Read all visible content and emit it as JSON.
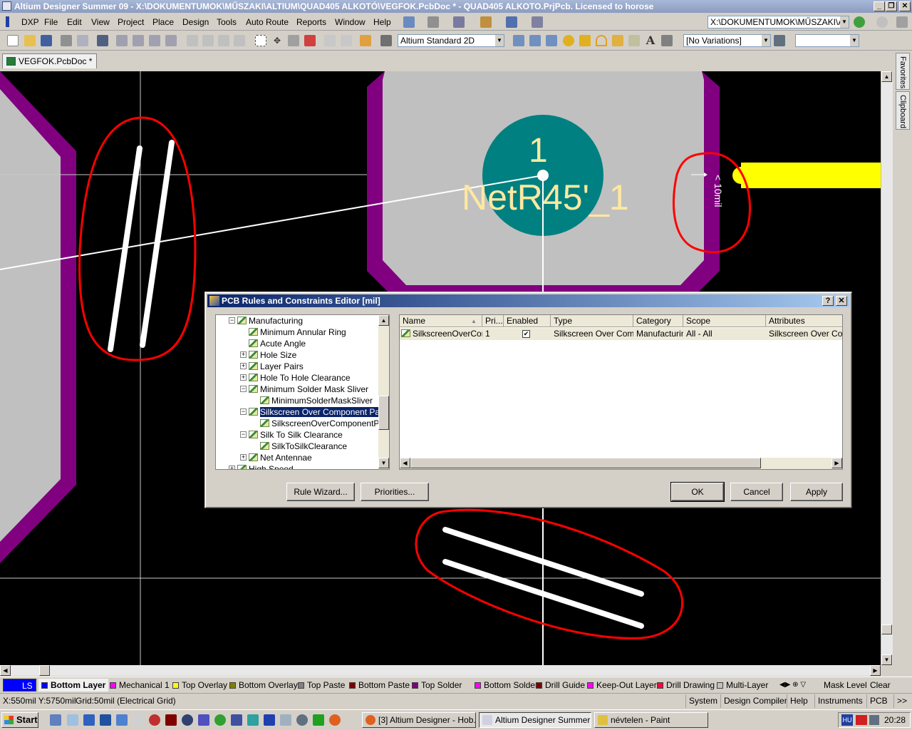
{
  "titlebar": {
    "text": "Altium Designer Summer 09 - X:\\DOKUMENTUMOK\\MŰSZAKI\\ALTIUM\\QUAD405 ALKOTÓ\\VEGFOK.PcbDoc * - QUAD405 ALKOTO.PrjPcb. Licensed to horose"
  },
  "menu": {
    "dxp": "DXP",
    "file": "File",
    "edit": "Edit",
    "view": "View",
    "project": "Project",
    "place": "Place",
    "design": "Design",
    "tools": "Tools",
    "autoroute": "Auto Route",
    "reports": "Reports",
    "window": "Window",
    "help": "Help"
  },
  "path_combo": "X:\\DOKUMENTUMOK\\MŰSZAKI\\ALTIUM",
  "toolbar": {
    "view_mode": "Altium Standard 2D",
    "variations": "[No Variations]",
    "extra": ""
  },
  "doc_tab": "VEGFOK.PcbDoc *",
  "side_tabs": {
    "favorites": "Favorites",
    "clipboard": "Clipboard"
  },
  "pcb": {
    "pad_number": "1",
    "net_name": "NetR45'_1",
    "clearance_label": "< 10mil"
  },
  "dialog": {
    "title": "PCB Rules and Constraints Editor [mil]",
    "help_btn": "?",
    "close_btn": "✕",
    "tree": [
      {
        "label": "Manufacturing",
        "level": 1,
        "expander": "−"
      },
      {
        "label": "Minimum Annular Ring",
        "level": 2,
        "expander": ""
      },
      {
        "label": "Acute Angle",
        "level": 2,
        "expander": ""
      },
      {
        "label": "Hole Size",
        "level": 2,
        "expander": "+"
      },
      {
        "label": "Layer Pairs",
        "level": 2,
        "expander": "+"
      },
      {
        "label": "Hole To Hole Clearance",
        "level": 2,
        "expander": "+"
      },
      {
        "label": "Minimum Solder Mask Sliver",
        "level": 2,
        "expander": "−"
      },
      {
        "label": "MinimumSolderMaskSliver",
        "level": 3,
        "expander": ""
      },
      {
        "label": "Silkscreen Over Component Pads",
        "level": 2,
        "expander": "−"
      },
      {
        "label": "SilkscreenOverComponentPad",
        "level": 3,
        "expander": ""
      },
      {
        "label": "Silk To Silk Clearance",
        "level": 2,
        "expander": "−"
      },
      {
        "label": "SilkToSilkClearance",
        "level": 3,
        "expander": ""
      },
      {
        "label": "Net Antennae",
        "level": 2,
        "expander": "+"
      },
      {
        "label": "High Speed",
        "level": 1,
        "expander": "+"
      }
    ],
    "columns": [
      "Name",
      "Pri...",
      "Enabled",
      "Type",
      "Category",
      "Scope",
      "Attributes"
    ],
    "row": {
      "name": "SilkscreenOverComp",
      "priority": "1",
      "enabled_mark": "✔",
      "type": "Silkscreen Over Compo",
      "category": "Manufacturing",
      "scope": "All   -   All",
      "attributes": "Silkscreen Over Comp"
    },
    "buttons": {
      "rule_wizard": "Rule Wizard...",
      "priorities": "Priorities...",
      "ok": "OK",
      "cancel": "Cancel",
      "apply": "Apply"
    }
  },
  "layers": [
    {
      "label": "LS",
      "color": "#0000ff"
    },
    {
      "label": "Bottom Layer",
      "color": "#0000ff"
    },
    {
      "label": "Mechanical 1",
      "color": "#ff00ff"
    },
    {
      "label": "Top Overlay",
      "color": "#ffff00"
    },
    {
      "label": "Bottom Overlay",
      "color": "#808000"
    },
    {
      "label": "Top Paste",
      "color": "#808080"
    },
    {
      "label": "Bottom Paste",
      "color": "#800000"
    },
    {
      "label": "Top Solder",
      "color": "#800080"
    },
    {
      "label": "Bottom Solder",
      "color": "#ff00ff"
    },
    {
      "label": "Drill Guide",
      "color": "#800000"
    },
    {
      "label": "Keep-Out Layer",
      "color": "#ff00ff"
    },
    {
      "label": "Drill Drawing",
      "color": "#ff0040"
    },
    {
      "label": "Multi-Layer",
      "color": "#c0c0c0"
    }
  ],
  "layerbar_right": {
    "mask_level": "Mask Level",
    "clear": "Clear"
  },
  "status": {
    "coords": "X:550mil Y:5750mil",
    "grid": "Grid:50mil",
    "grid_type": "(Electrical Grid)",
    "system": "System",
    "design_compiler": "Design Compiler",
    "help": "Help",
    "instruments": "Instruments",
    "pcb": "PCB",
    "more": ">>"
  },
  "taskbar": {
    "start": "Start",
    "tasks": [
      "[3] Altium Designer - Hob...",
      "Altium Designer Summer ...",
      "névtelen - Paint"
    ],
    "tray_lang": "HU",
    "clock": "20:28"
  },
  "colors": {
    "pad_gray": "#c0c0c0",
    "pad_ring": "#800080",
    "via_teal": "#008080",
    "net_text": "#ffe8a0",
    "track_yellow": "#ffff00",
    "annotation_red": "#ff0000"
  }
}
